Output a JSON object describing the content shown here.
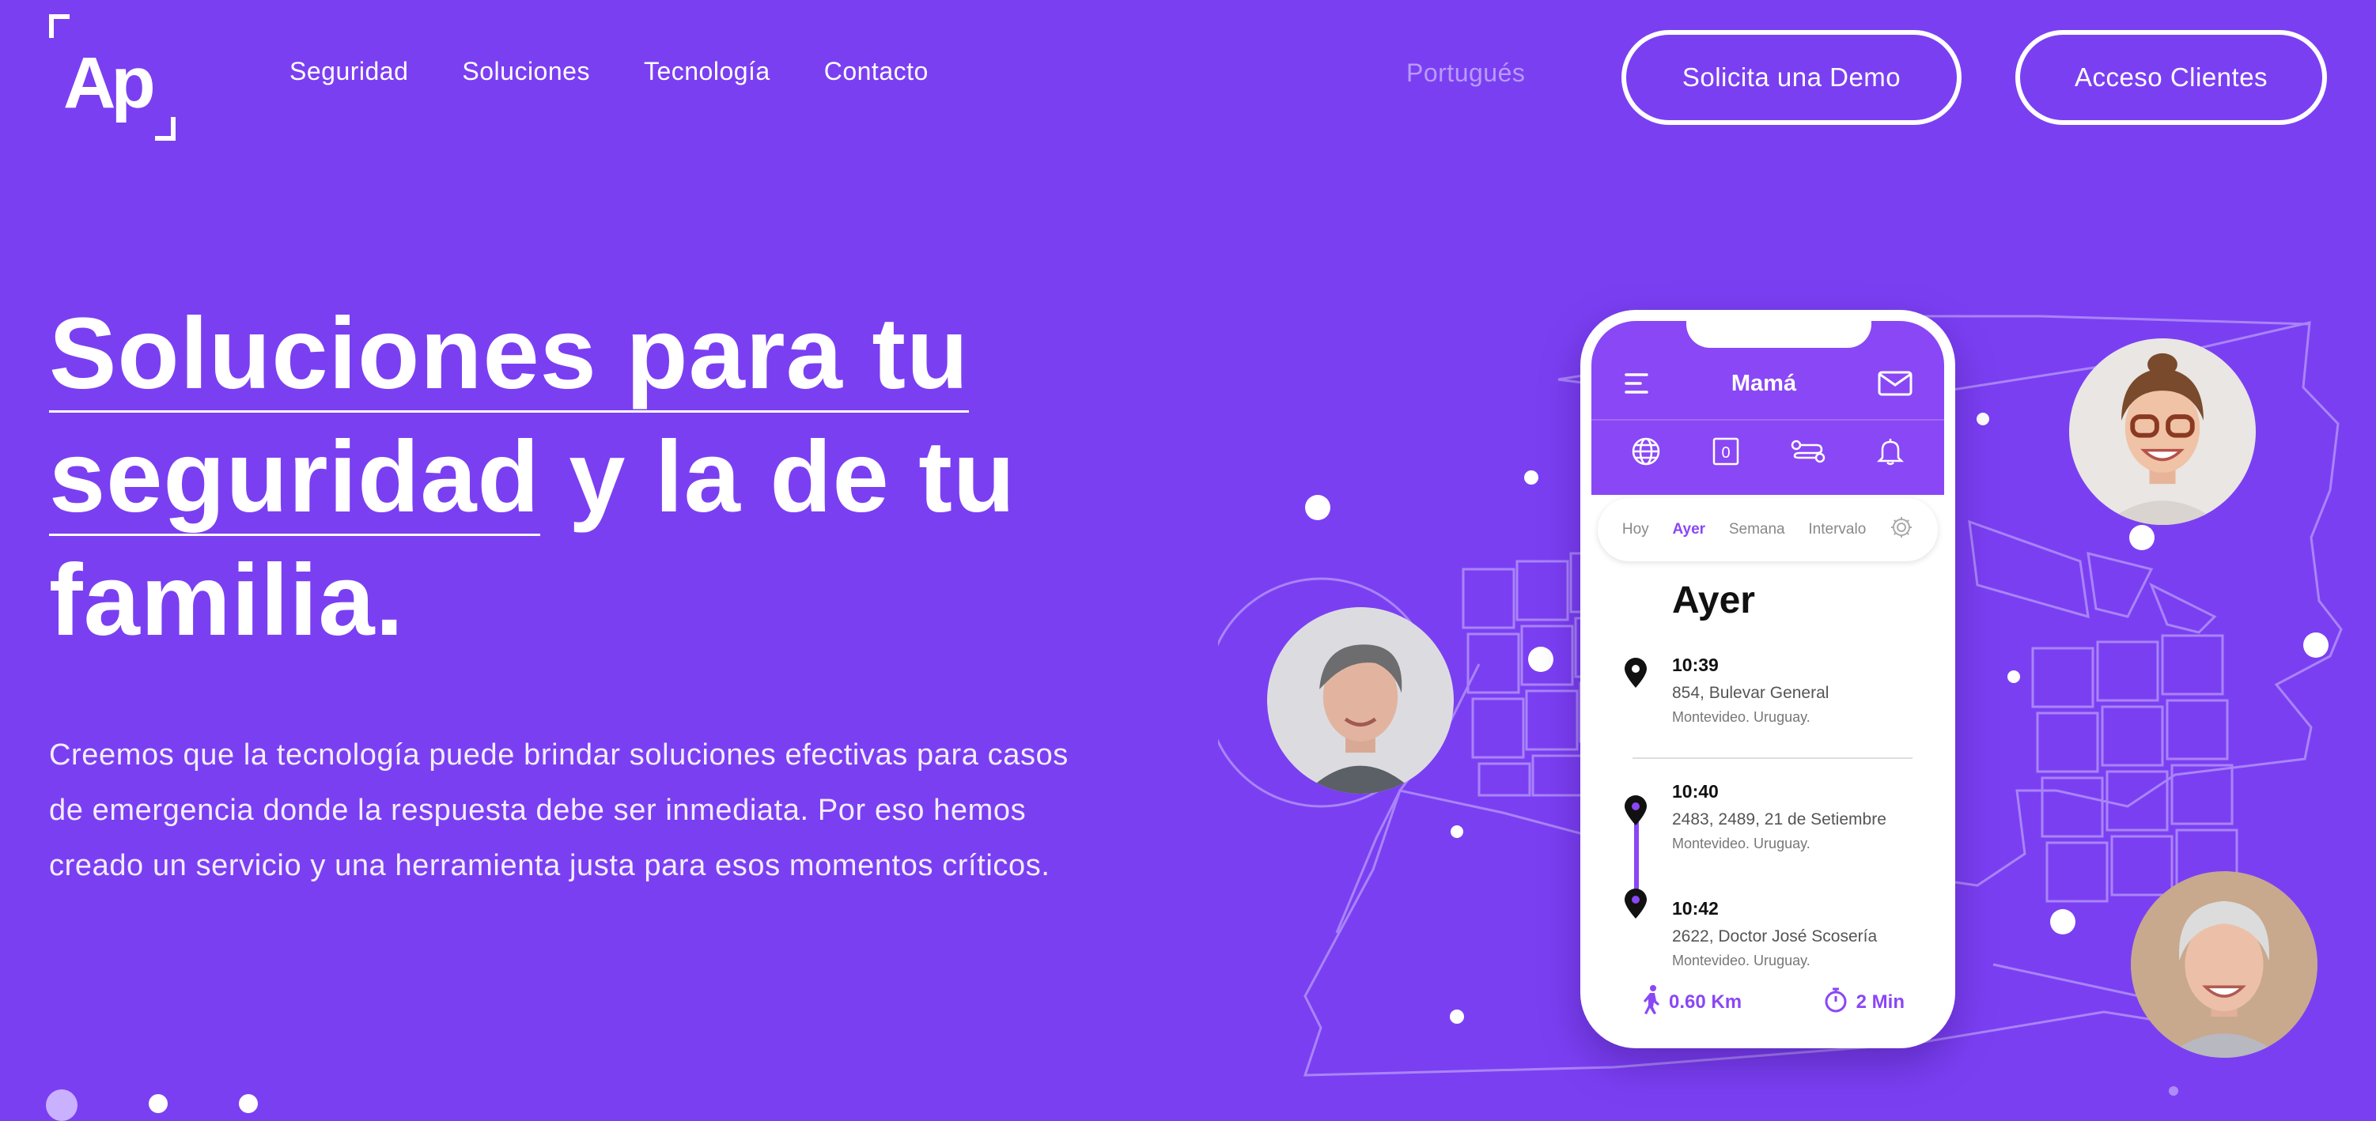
{
  "header": {
    "logo_text": "Ap",
    "nav": [
      "Seguridad",
      "Soluciones",
      "Tecnología",
      "Contacto"
    ],
    "language": "Portugués",
    "demo_button": "Solicita una Demo",
    "access_button": "Acceso Clientes"
  },
  "hero": {
    "headline": {
      "line1": "Soluciones para tu",
      "line2_underlined": "seguridad",
      "line2_rest": " y la de tu",
      "line3": "familia."
    },
    "lead": "Creemos que la tecnología puede brindar soluciones efectivas para casos de emergencia donde la respuesta debe ser inmediata. Por eso hemos creado un servicio y una herramienta justa para esos momentos críticos."
  },
  "phone": {
    "title": "Mamá",
    "tabs": [
      "Hoy",
      "Ayer",
      "Semana",
      "Intervalo"
    ],
    "active_tab": "Ayer",
    "day_heading": "Ayer",
    "entries": [
      {
        "time": "10:39",
        "address": "854, Bulevar General",
        "city": "Montevideo. Uruguay."
      },
      {
        "time": "10:40",
        "address": "2483, 2489, 21 de Setiembre",
        "city": "Montevideo. Uruguay."
      },
      {
        "time": "10:42",
        "address": "2622, Doctor José Scosería",
        "city": "Montevideo. Uruguay."
      }
    ],
    "distance": "0.60 Km",
    "duration": "2 Min"
  },
  "colors": {
    "background": "#7b3ff2",
    "phone_accent": "#8a47f5",
    "language_muted": "#b89bfb"
  },
  "icons": [
    "menu-icon",
    "mail-icon",
    "globe-icon",
    "zero-box-icon",
    "route-icon",
    "bell-icon",
    "gear-icon",
    "location-pin-icon",
    "walking-icon",
    "timer-icon"
  ]
}
